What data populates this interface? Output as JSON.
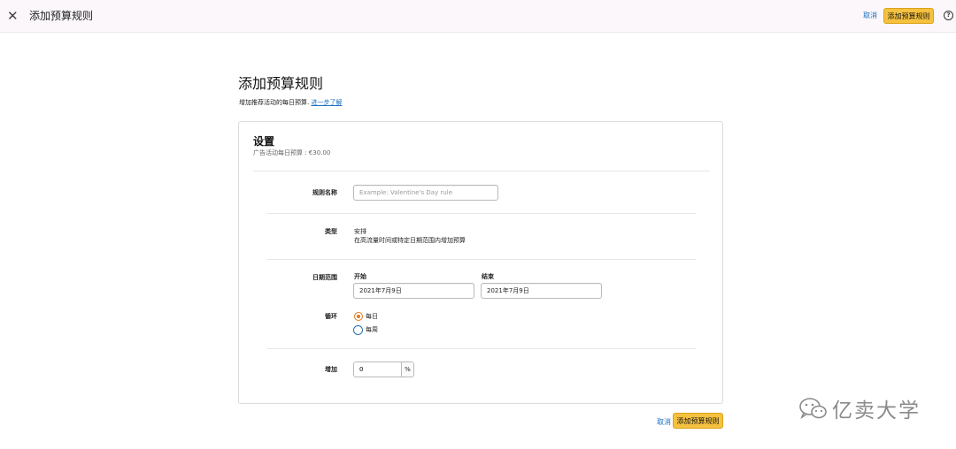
{
  "header": {
    "title": "添加预算规则",
    "cancel_label": "取消",
    "add_label": "添加预算规则",
    "close_icon": "close-icon",
    "help_icon": "help-icon",
    "help_glyph": "?"
  },
  "page": {
    "title": "添加预算规则",
    "subtitle": "增加推荐活动的每日预算.",
    "learn_more": "进一步了解"
  },
  "settings": {
    "title": "设置",
    "daily_budget": "广告活动每日预算 : €30.00",
    "rule_name": {
      "label": "规则名称",
      "placeholder": "Example: Valentine's Day rule",
      "value": ""
    },
    "type": {
      "label": "类型",
      "value": "安排",
      "description": "在高流量时间或特定日期范围内增加预算"
    },
    "date_range": {
      "label": "日期范围",
      "start_label": "开始",
      "start_value": "2021年7月9日",
      "end_label": "结束",
      "end_value": "2021年7月9日"
    },
    "recurrence": {
      "label": "循环",
      "options": [
        {
          "label": "每日",
          "selected": true
        },
        {
          "label": "每周",
          "selected": false
        }
      ]
    },
    "increase": {
      "label": "增加",
      "value": "0",
      "unit": "%"
    }
  },
  "footer": {
    "cancel_label": "取消",
    "add_label": "添加预算规则"
  },
  "watermark": {
    "text": "亿卖大学",
    "icon": "wechat-icon"
  },
  "colors": {
    "accent_yellow": "#f5c13f",
    "link_blue": "#1a6fc1",
    "radio_orange": "#e07a1f"
  }
}
